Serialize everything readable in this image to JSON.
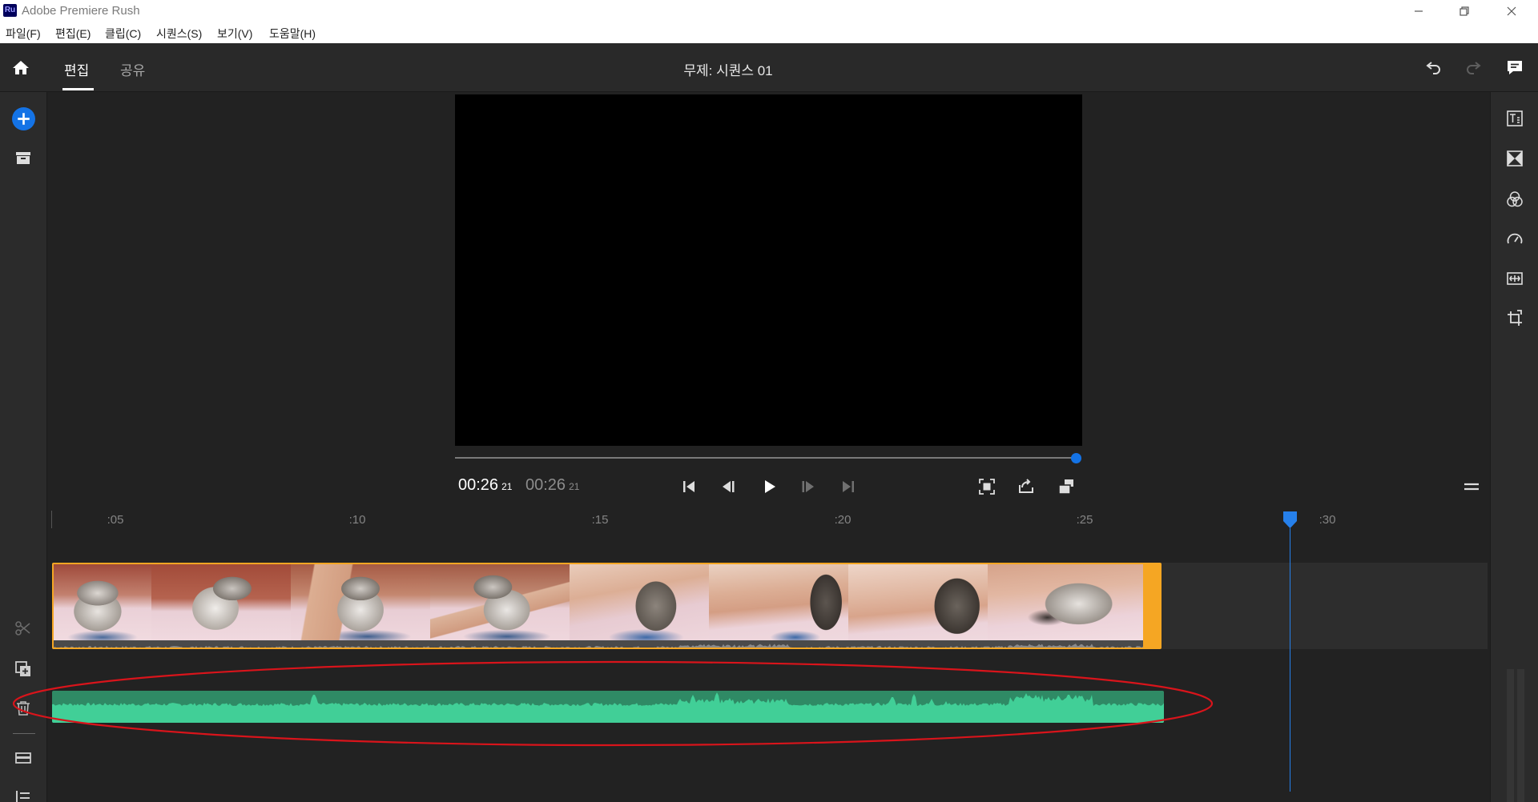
{
  "app": {
    "logo": "Ru",
    "title": "Adobe Premiere Rush"
  },
  "window_controls": [
    "minimize-icon",
    "restore-icon",
    "close-icon"
  ],
  "menu": [
    "파일(F)",
    "편집(E)",
    "클립(C)",
    "시퀀스(S)",
    "보기(V)",
    "도움말(H)"
  ],
  "header": {
    "tabs": [
      {
        "label": "편집",
        "active": true
      },
      {
        "label": "공유",
        "active": false
      }
    ],
    "project_title": "무제: 시퀀스 01",
    "left_icon": "home-icon",
    "right_icons": [
      "undo-icon",
      "redo-icon",
      "feedback-icon"
    ]
  },
  "left_toolbar": {
    "top_icons": [
      "add-media-icon",
      "media-bin-icon"
    ],
    "bottom_icons": [
      "split-clip-icon",
      "duplicate-icon",
      "delete-icon",
      "add-track-icon",
      "track-list-icon"
    ]
  },
  "right_toolbar": {
    "icons": [
      "graphics-icon",
      "transitions-icon",
      "color-icon",
      "speed-icon",
      "audio-icon",
      "transform-icon"
    ]
  },
  "player": {
    "current_time": "00:26",
    "current_frames": "21",
    "duration": "00:26",
    "duration_frames": "21",
    "scrubber_progress": 1.0,
    "transport_icons": [
      "skip-to-start-icon",
      "step-back-icon",
      "play-icon",
      "step-forward-icon",
      "skip-to-end-icon"
    ],
    "view_icons": [
      "fullscreen-icon",
      "loop-icon",
      "aspect-ratio-icon"
    ],
    "menu_icon": "hamburger-icon"
  },
  "timeline": {
    "ruler_labels": [
      ":05",
      ":10",
      ":15",
      ":20",
      ":25",
      ":30"
    ]
  },
  "colors": {
    "accent": "#1473e6",
    "clip": "#f5a623",
    "audio_bg": "#2f8a65",
    "audio_wave": "#41cf97",
    "annotation_ring": "#d9141b"
  }
}
